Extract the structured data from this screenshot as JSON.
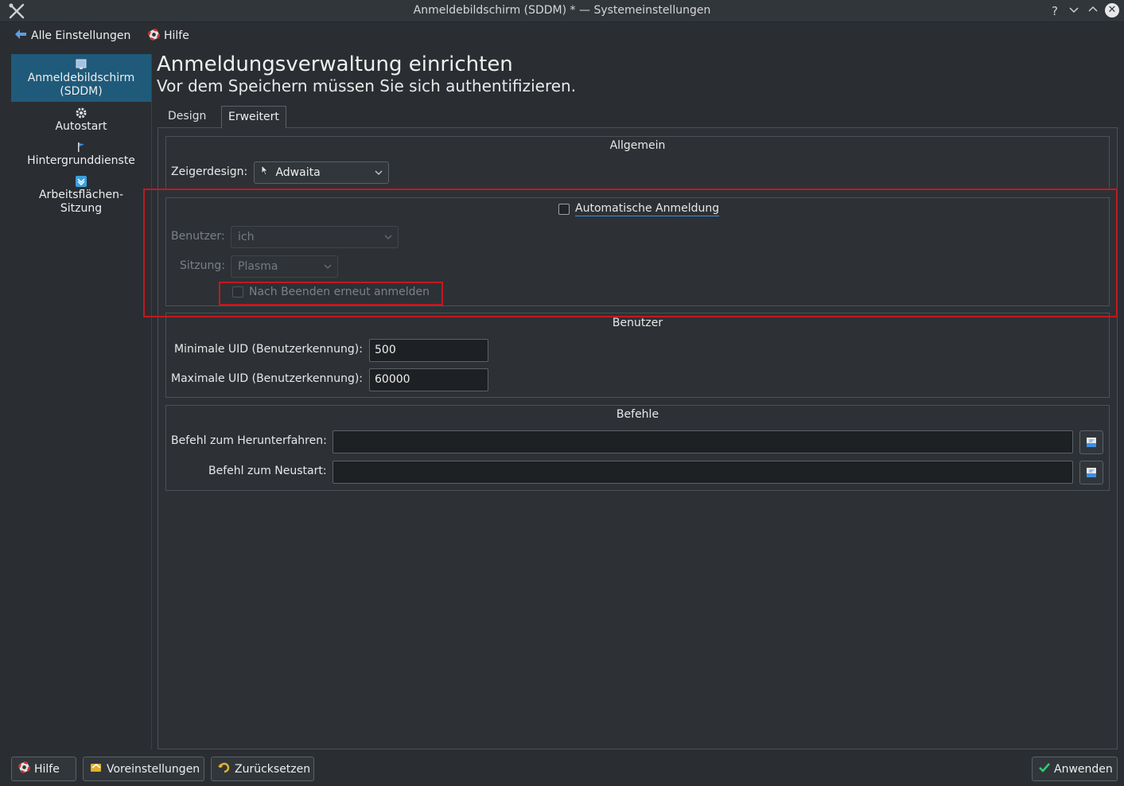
{
  "window": {
    "title": "Anmeldebildschirm (SDDM) * — Systemeinstellungen",
    "help_glyph": "?",
    "minimize_glyph": "⌄",
    "maximize_glyph": "⌃",
    "close_glyph": "✕"
  },
  "toolbar": {
    "all_settings_label": "Alle Einstellungen",
    "help_label": "Hilfe"
  },
  "sidebar": {
    "items": [
      {
        "label": "Anmeldebildschirm\n(SDDM)",
        "icon": "monitor-icon",
        "selected": true
      },
      {
        "label": "Autostart",
        "icon": "gear-icon"
      },
      {
        "label": "Hintergrunddienste",
        "icon": "flag-icon"
      },
      {
        "label": "Arbeitsflächen-\nSitzung",
        "icon": "session-icon"
      }
    ]
  },
  "header": {
    "title": "Anmeldungsverwaltung einrichten",
    "subtitle": "Vor dem Speichern müssen Sie sich authentifizieren."
  },
  "tabs": [
    {
      "label": "Design",
      "active": false
    },
    {
      "label": "Erweitert",
      "active": true
    }
  ],
  "general": {
    "title": "Allgemein",
    "cursor_label": "Zeigerdesign:",
    "cursor_value": "Adwaita"
  },
  "autologin": {
    "checkbox_label": "Automatische Anmeldung",
    "checked": false,
    "user_label": "Benutzer:",
    "user_value": "ich",
    "session_label": "Sitzung:",
    "session_value": "Plasma",
    "relogin_label": "Nach Beenden erneut anmelden",
    "relogin_checked": false
  },
  "users": {
    "title": "Benutzer",
    "min_uid_label": "Minimale UID (Benutzerkennung):",
    "min_uid_value": "500",
    "max_uid_label": "Maximale UID (Benutzerkennung):",
    "max_uid_value": "60000"
  },
  "commands": {
    "title": "Befehle",
    "halt_label": "Befehl zum Herunterfahren:",
    "halt_value": "",
    "reboot_label": "Befehl zum Neustart:",
    "reboot_value": ""
  },
  "buttons": {
    "help": "Hilfe",
    "defaults": "Voreinstellungen",
    "reset": "Zurücksetzen",
    "apply": "Anwenden"
  },
  "colors": {
    "accent": "#1f5a7a",
    "highlight": "#c0191f",
    "apply_check": "#2ecc71"
  }
}
